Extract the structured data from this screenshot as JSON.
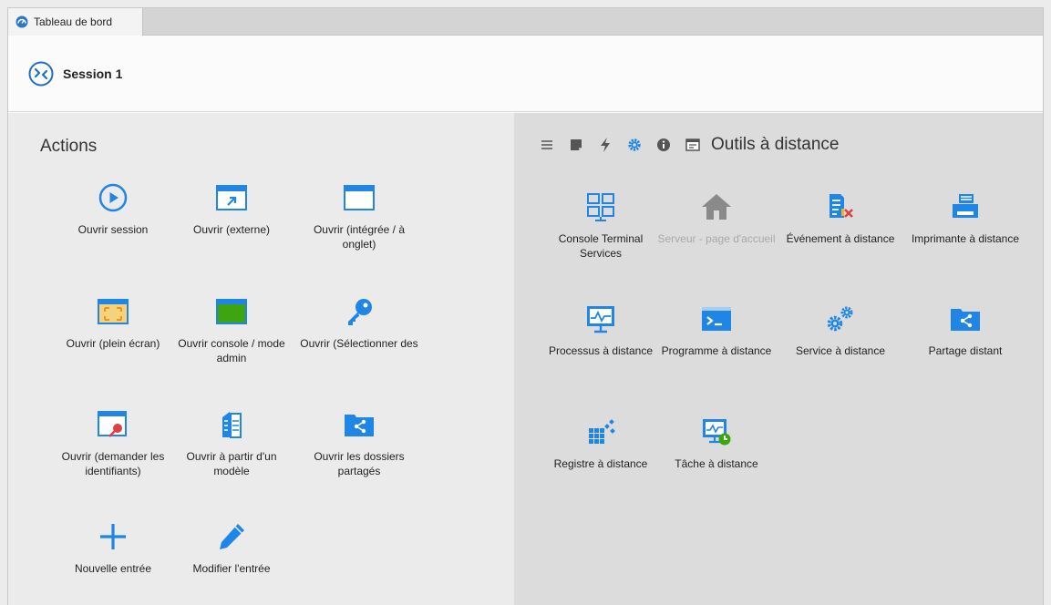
{
  "tab": {
    "label": "Tableau de bord"
  },
  "session": {
    "title": "Session 1"
  },
  "actions": {
    "title": "Actions",
    "items": [
      {
        "label": "Ouvrir session",
        "icon": "play-circle-icon"
      },
      {
        "label": "Ouvrir (externe)",
        "icon": "external-window-icon"
      },
      {
        "label": "Ouvrir (intégrée / à onglet)",
        "icon": "tabbed-window-icon"
      },
      {
        "label": "Ouvrir (plein écran)",
        "icon": "fullscreen-icon"
      },
      {
        "label": "Ouvrir console / mode admin",
        "icon": "console-window-icon"
      },
      {
        "label": "Ouvrir (Sélectionner des",
        "icon": "key-icon"
      },
      {
        "label": "Ouvrir (demander les identifiants)",
        "icon": "credentials-window-icon"
      },
      {
        "label": "Ouvrir à partir d'un modèle",
        "icon": "template-icon"
      },
      {
        "label": "Ouvrir les dossiers partagés",
        "icon": "shared-folder-icon"
      },
      {
        "label": "Nouvelle entrée",
        "icon": "plus-icon"
      },
      {
        "label": "Modifier l'entrée",
        "icon": "pencil-icon"
      }
    ]
  },
  "tools": {
    "title": "Outils à distance",
    "toolbar": [
      "list-icon",
      "note-icon",
      "lightning-icon",
      "gear-icon",
      "info-icon",
      "window-icon"
    ],
    "items": [
      {
        "label": "Console Terminal Services",
        "icon": "terminal-services-icon"
      },
      {
        "label": "Serveur - page d'accueil",
        "icon": "home-icon",
        "disabled": true
      },
      {
        "label": "Événement à distance",
        "icon": "event-log-icon"
      },
      {
        "label": "Imprimante à distance",
        "icon": "printer-icon"
      },
      {
        "label": "Processus à distance",
        "icon": "process-monitor-icon"
      },
      {
        "label": "Programme à distance",
        "icon": "program-icon"
      },
      {
        "label": "Service à distance",
        "icon": "service-gears-icon"
      },
      {
        "label": "Partage distant",
        "icon": "share-folder-icon"
      },
      {
        "label": "Registre à distance",
        "icon": "registry-icon"
      },
      {
        "label": "Tâche à distance",
        "icon": "task-icon"
      }
    ]
  },
  "colors": {
    "accent": "#1f86e5",
    "disabled": "#a9a9a9",
    "console_green": "#3ea40f",
    "alert_red": "#e04040"
  }
}
